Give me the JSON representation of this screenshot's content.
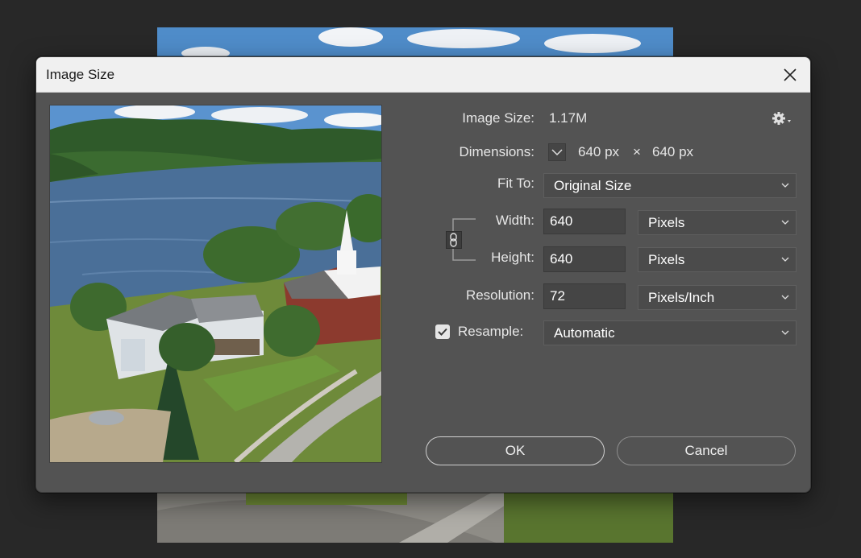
{
  "dialog": {
    "title": "Image Size",
    "close_icon": "close-icon"
  },
  "info": {
    "image_size_label": "Image Size:",
    "image_size_value": "1.17M",
    "dimensions_label": "Dimensions:",
    "dim_width": "640 px",
    "dim_sep": "×",
    "dim_height": "640 px",
    "settings_icon": "gear-icon"
  },
  "fit_to": {
    "label": "Fit To:",
    "value": "Original Size"
  },
  "width": {
    "label": "Width:",
    "value": "640",
    "unit": "Pixels"
  },
  "height": {
    "label": "Height:",
    "value": "640",
    "unit": "Pixels"
  },
  "resolution": {
    "label": "Resolution:",
    "value": "72",
    "unit": "Pixels/Inch"
  },
  "resample": {
    "label": "Resample:",
    "checked": true,
    "value": "Automatic"
  },
  "buttons": {
    "ok": "OK",
    "cancel": "Cancel"
  },
  "colors": {
    "dialog_bg": "#535353",
    "titlebar_bg": "#f0f0f0",
    "app_bg": "#282828"
  }
}
